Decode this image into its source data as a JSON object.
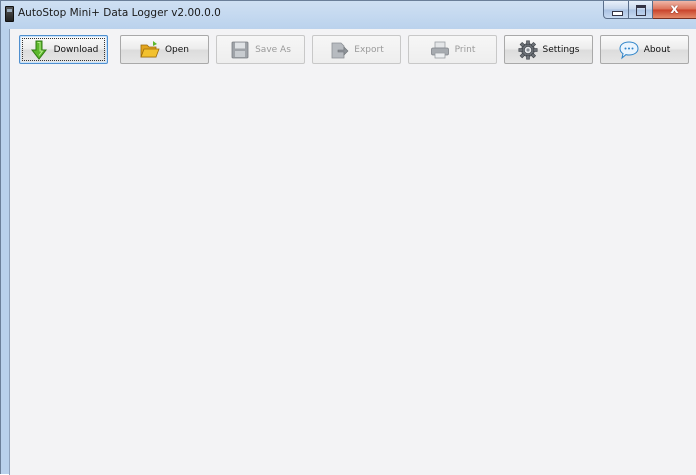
{
  "window": {
    "title": "AutoStop Mini+ Data Logger v2.00.0.0",
    "caption": {
      "close_glyph": "x"
    }
  },
  "toolbar": {
    "buttons": [
      {
        "label": "Download",
        "icon": "download-arrow-icon",
        "enabled": true,
        "focused": true
      },
      {
        "label": "Open",
        "icon": "folder-open-icon",
        "enabled": true,
        "focused": false
      },
      {
        "label": "Save As",
        "icon": "floppy-disk-icon",
        "enabled": false,
        "focused": false
      },
      {
        "label": "Export",
        "icon": "export-icon",
        "enabled": false,
        "focused": false
      },
      {
        "label": "Print",
        "icon": "printer-icon",
        "enabled": false,
        "focused": false
      },
      {
        "label": "Settings",
        "icon": "gear-icon",
        "enabled": true,
        "focused": false
      },
      {
        "label": "About",
        "icon": "speech-bubble-icon",
        "enabled": true,
        "focused": false
      }
    ]
  },
  "colors": {
    "client_background": "#f3f3f5",
    "title_bar": "#b9d1ec",
    "close_button": "#c8412a",
    "download_arrow": "#5cb82c",
    "folder": "#f2c12e"
  }
}
